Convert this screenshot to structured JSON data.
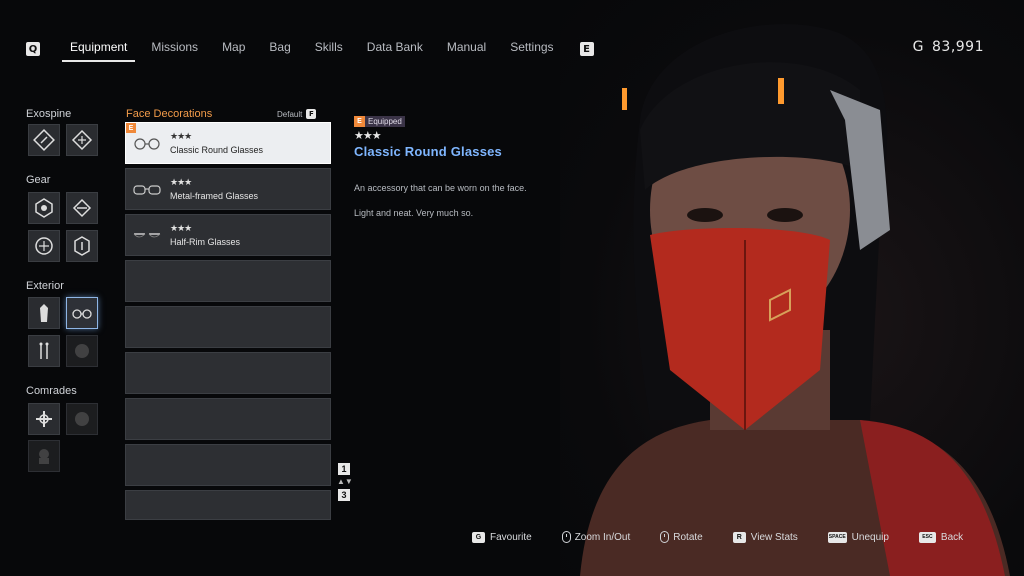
{
  "nav": {
    "left_key": "Q",
    "right_key": "E",
    "tabs": [
      "Equipment",
      "Missions",
      "Map",
      "Bag",
      "Skills",
      "Data Bank",
      "Manual",
      "Settings"
    ],
    "active_tab": "Equipment"
  },
  "currency": {
    "symbol": "G",
    "amount": "83,991"
  },
  "categories": {
    "exospine": "Exospine",
    "gear": "Gear",
    "exterior": "Exterior",
    "comrades": "Comrades"
  },
  "list": {
    "title": "Face Decorations",
    "sort_label": "Default",
    "sort_key": "F",
    "items": [
      {
        "stars": "★★★",
        "name": "Classic Round Glasses",
        "equipped_badge": "E",
        "selected": true
      },
      {
        "stars": "★★★",
        "name": "Metal-framed Glasses"
      },
      {
        "stars": "★★★",
        "name": "Half-Rim Glasses"
      }
    ],
    "empty_slots": 6
  },
  "pager": {
    "current": "1",
    "total": "3",
    "arrows": "▲▼"
  },
  "detail": {
    "equipped_key": "E",
    "equipped_label": "Equipped",
    "stars": "★★★",
    "title": "Classic Round Glasses",
    "description": "An accessory that can be worn on the face.",
    "flavor": "Light and neat. Very much so."
  },
  "controls": {
    "favourite_key": "G",
    "favourite": "Favourite",
    "zoom": "Zoom In/Out",
    "rotate": "Rotate",
    "stats_key": "R",
    "stats": "View Stats",
    "unequip_key": "SPACE",
    "unequip": "Unequip",
    "back_key": "ESC",
    "back": "Back"
  },
  "colors": {
    "accent_orange": "#f29b4a",
    "title_blue": "#7fb6ff",
    "selected_outline": "#8fb6e6"
  }
}
